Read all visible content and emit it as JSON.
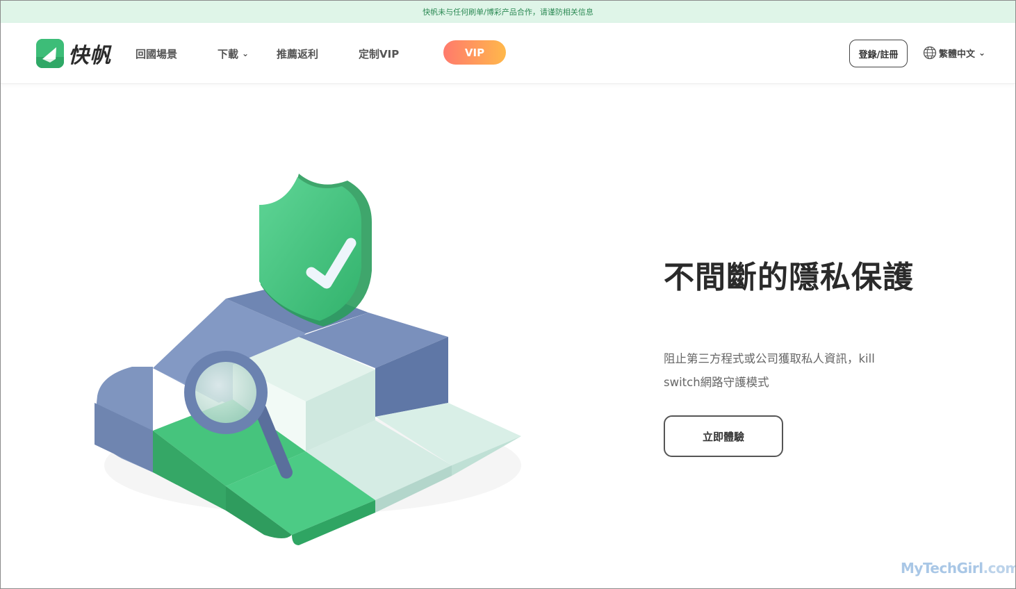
{
  "notice": {
    "text": "快帆未与任何刷单/博彩产品合作，请谨防相关信息"
  },
  "header": {
    "logo_text": "快帆",
    "nav": [
      {
        "label": "回國場景"
      },
      {
        "label": "下載",
        "has_dropdown": true
      },
      {
        "label": "推薦返利"
      },
      {
        "label": "定制VIP"
      }
    ],
    "vip_label": "VIP",
    "login_label": "登錄/註冊",
    "language_label": "繁體中文"
  },
  "hero": {
    "title": "不間斷的隱私保護",
    "description": "阻止第三方程式或公司獲取私人資訊，kill switch網路守護模式",
    "cta_label": "立即體驗"
  },
  "watermark": {
    "part1": "MyTechGirl",
    "part2": ".com"
  },
  "icons": {
    "logo": "paper-plane-icon",
    "dropdown": "chevron-down-icon",
    "language": "globe-icon",
    "illustration": [
      "shield-check-icon",
      "magnifier-icon"
    ]
  },
  "colors": {
    "brand_green": "#3dbd78",
    "notice_bg": "#dff5e8",
    "vip_gradient_start": "#ff7a6c",
    "vip_gradient_end": "#ffb84b",
    "block_blue": "#7189b4",
    "block_mint": "#d8eee5"
  }
}
